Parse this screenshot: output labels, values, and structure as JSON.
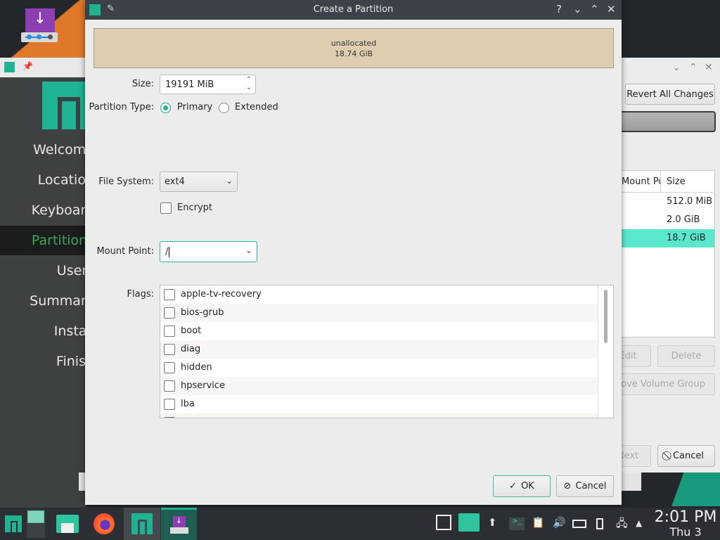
{
  "desktop": {
    "installer_icon": "install-manjaro-icon"
  },
  "background_window": {
    "sidebar": {
      "items": [
        {
          "label": "Welcome",
          "active": false
        },
        {
          "label": "Location",
          "active": false
        },
        {
          "label": "Keyboard",
          "active": false
        },
        {
          "label": "Partitions",
          "active": true
        },
        {
          "label": "Users",
          "active": false
        },
        {
          "label": "Summary",
          "active": false
        },
        {
          "label": "Install",
          "active": false
        },
        {
          "label": "Finish",
          "active": false
        }
      ]
    },
    "revert_button": "Revert All Changes",
    "table": {
      "headers": [
        "Mount Point",
        "Size"
      ],
      "rows": [
        {
          "mount": "",
          "size": "512.0 MiB"
        },
        {
          "mount": "",
          "size": "2.0 GiB"
        },
        {
          "mount": "",
          "size": "18.7 GiB",
          "selected": true
        }
      ]
    },
    "edit_button": "Edit",
    "delete_button": "Delete",
    "remove_vg_button": "Remove Volume Group",
    "next_button": "Next",
    "cancel_button": "Cancel"
  },
  "dialog": {
    "title": "Create a Partition",
    "controls": {
      "help": "?",
      "minimize": "⌄",
      "maximize": "⌃",
      "close": "✕"
    },
    "partition_bar": {
      "label": "unallocated",
      "size": "18.74 GiB",
      "color": "#ddceb0"
    },
    "size": {
      "label": "Size:",
      "value": "19191 MiB"
    },
    "partition_type": {
      "label": "Partition Type:",
      "options": [
        {
          "label": "Primary",
          "checked": true
        },
        {
          "label": "Extended",
          "checked": false
        }
      ]
    },
    "file_system": {
      "label": "File System:",
      "value": "ext4"
    },
    "encrypt": {
      "label": "Encrypt",
      "checked": false
    },
    "mount_point": {
      "label": "Mount Point:",
      "value": "/"
    },
    "flags": {
      "label": "Flags:",
      "items": [
        {
          "label": "apple-tv-recovery",
          "checked": false
        },
        {
          "label": "bios-grub",
          "checked": false
        },
        {
          "label": "boot",
          "checked": false
        },
        {
          "label": "diag",
          "checked": false
        },
        {
          "label": "hidden",
          "checked": false
        },
        {
          "label": "hpservice",
          "checked": false
        },
        {
          "label": "lba",
          "checked": false
        }
      ]
    },
    "ok_button": "OK",
    "cancel_button": "Cancel"
  },
  "taskbar": {
    "clock_time": "2:01 PM",
    "clock_date": "Thu 3",
    "accent": "#1db393"
  }
}
